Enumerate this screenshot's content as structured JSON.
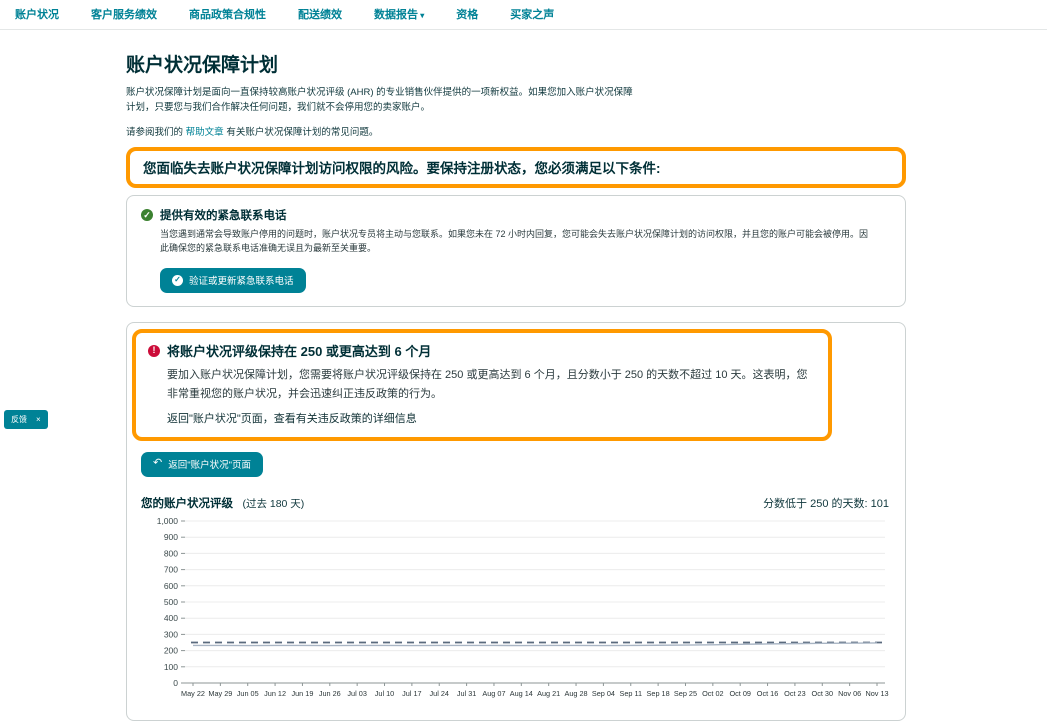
{
  "nav": {
    "items": [
      {
        "label": "账户状况",
        "dropdown": false
      },
      {
        "label": "客户服务绩效",
        "dropdown": false
      },
      {
        "label": "商品政策合规性",
        "dropdown": false
      },
      {
        "label": "配送绩效",
        "dropdown": false
      },
      {
        "label": "数据报告",
        "dropdown": true
      },
      {
        "label": "资格",
        "dropdown": false
      },
      {
        "label": "买家之声",
        "dropdown": false
      }
    ]
  },
  "page": {
    "title": "账户状况保障计划",
    "intro": "账户状况保障计划是面向一直保持较高账户状况评级 (AHR) 的专业销售伙伴提供的一项新权益。如果您加入账户状况保障计划，只要您与我们合作解决任何问题，我们就不会停用您的卖家账户。",
    "help_prefix": "请参阅我们的",
    "help_link_label": "帮助文章",
    "help_suffix": "有关账户状况保障计划的常见问题。",
    "warning_headline": "您面临失去账户状况保障计划访问权限的风险。要保持注册状态，您必须满足以下条件:"
  },
  "requirements": {
    "contact": {
      "title": "提供有效的紧急联系电话",
      "body": "当您遇到通常会导致账户停用的问题时，账户状况专员将主动与您联系。如果您未在 72 小时内回复，您可能会失去账户状况保障计划的访问权限，并且您的账户可能会被停用。因此确保您的紧急联系电话准确无误且为最新至关重要。",
      "button_label": "验证或更新紧急联系电话"
    },
    "rating": {
      "title": "将账户状况评级保持在 250 或更高达到 6 个月",
      "body": "要加入账户状况保障计划，您需要将账户状况评级保持在 250 或更高达到 6 个月，且分数小于 250 的天数不超过 10 天。这表明，您非常重视您的账户状况，并会迅速纠正违反政策的行为。",
      "link_line": "返回\"账户状况\"页面，查看有关违反政策的详细信息",
      "button_label": "返回\"账户状况\"页面"
    }
  },
  "chart": {
    "title": "您的账户状况评级",
    "subtitle": "(过去 180 天)",
    "days_below_note": "分数低于 250 的天数: 101"
  },
  "chart_data": {
    "type": "line",
    "title": "您的账户状况评级 (过去 180 天)",
    "x": [
      "May 22",
      "May 29",
      "Jun 05",
      "Jun 12",
      "Jun 19",
      "Jun 26",
      "Jul 03",
      "Jul 10",
      "Jul 17",
      "Jul 24",
      "Jul 31",
      "Aug 07",
      "Aug 14",
      "Aug 21",
      "Aug 28",
      "Sep 04",
      "Sep 11",
      "Sep 18",
      "Sep 25",
      "Oct 02",
      "Oct 09",
      "Oct 16",
      "Oct 23",
      "Oct 30",
      "Nov 06",
      "Nov 13"
    ],
    "series": [
      {
        "name": "账户状况评级",
        "values": [
          232,
          232,
          231,
          232,
          232,
          231,
          232,
          232,
          231,
          232,
          232,
          232,
          231,
          232,
          232,
          231,
          232,
          233,
          234,
          236,
          239,
          241,
          243,
          245,
          246,
          247
        ]
      }
    ],
    "threshold": {
      "value": 250,
      "style": "dashed"
    },
    "ylim": [
      0,
      1000
    ],
    "yticks": [
      0,
      100,
      200,
      300,
      400,
      500,
      600,
      700,
      800,
      900,
      1000
    ],
    "grid": "horizontal",
    "legend": "none",
    "days_below_250": 101
  },
  "feedback": {
    "label": "反馈",
    "close_icon": "×"
  },
  "colors": {
    "accent_teal": "#008296",
    "annotation_orange": "#FF9900",
    "success_green": "#3B8130",
    "alert_red": "#CC0C39",
    "grid_line": "#ececec",
    "axis_line": "#8d9696",
    "threshold_line": "#5a6a7d",
    "series_line": "#a9b5c4"
  }
}
